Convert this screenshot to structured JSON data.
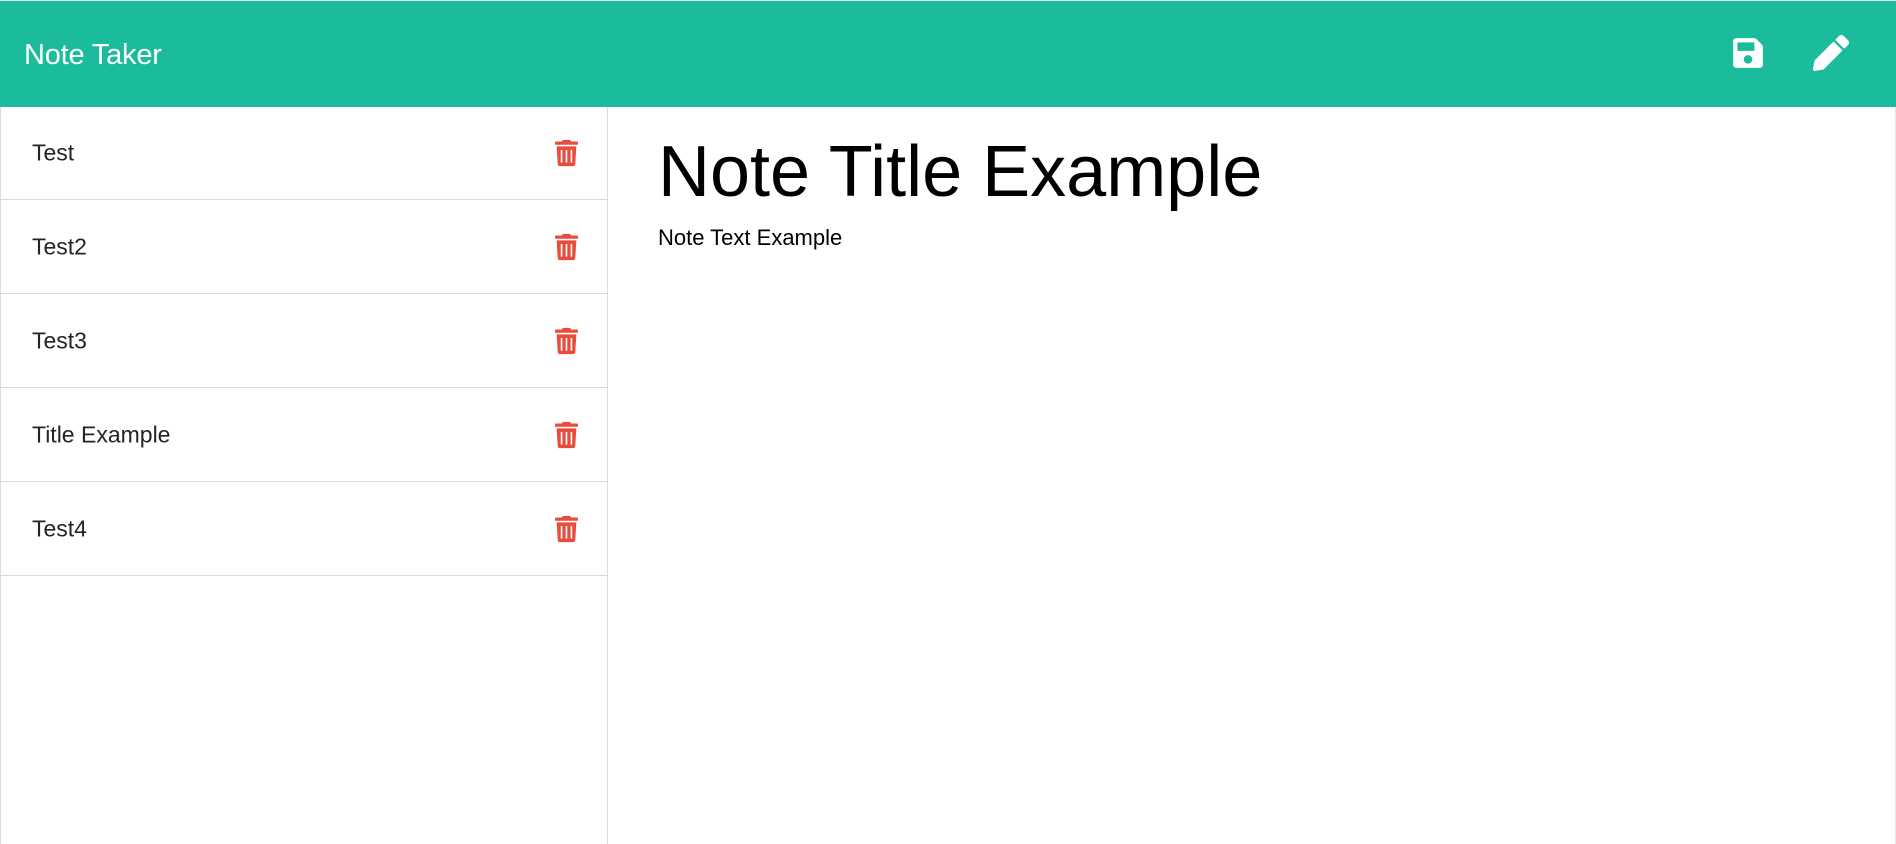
{
  "app": {
    "brand": "Note Taker"
  },
  "toolbar": {
    "save_icon": "save-icon",
    "write_icon": "pencil-icon"
  },
  "notes": [
    {
      "title": "Test",
      "delete_icon": "trash-icon"
    },
    {
      "title": "Test2",
      "delete_icon": "trash-icon"
    },
    {
      "title": "Test3",
      "delete_icon": "trash-icon"
    },
    {
      "title": "Title Example",
      "delete_icon": "trash-icon"
    },
    {
      "title": "Test4",
      "delete_icon": "trash-icon"
    }
  ],
  "editor": {
    "title_value": "Note Title Example",
    "text_value": "Note Text Example"
  },
  "colors": {
    "navbar": "#1abc9c",
    "delete": "#e74c3c",
    "nav_icon": "#ffffff"
  }
}
